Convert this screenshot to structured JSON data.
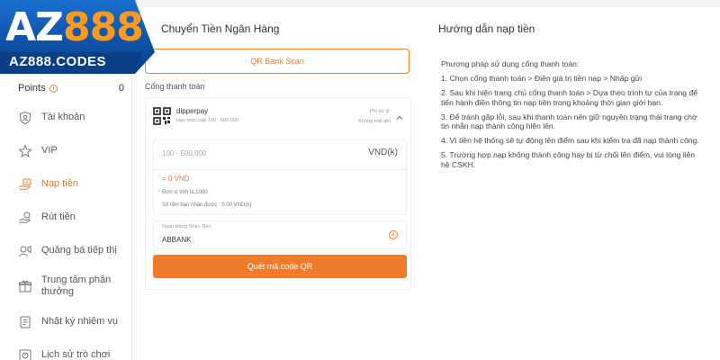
{
  "logo": {
    "brand_a": "AZ",
    "brand_n": "888",
    "url": "AZ888.CODES"
  },
  "sidebar": {
    "points_label": "Points",
    "points_value": "0",
    "items": [
      {
        "label": "Tài khoản",
        "icon": "user-shield-icon"
      },
      {
        "label": "VIP",
        "icon": "vip-star-icon"
      },
      {
        "label": "Nạp tiền",
        "icon": "deposit-hand-icon",
        "active": true
      },
      {
        "label": "Rút tiền",
        "icon": "withdraw-hand-icon"
      },
      {
        "label": "Quảng bá tiếp thị",
        "icon": "promotion-icon"
      },
      {
        "label": "Trung tâm phần thưởng",
        "icon": "gift-icon"
      },
      {
        "label": "Nhật ký nhiệm vụ",
        "icon": "task-log-icon"
      },
      {
        "label": "Lịch sử trò chơi",
        "icon": "history-icon"
      }
    ]
  },
  "main": {
    "title_left": "Chuyển Tiền Ngân Hàng",
    "title_right": "Hướng dẫn nạp tiền",
    "qr_tab": "QR Bank Scan",
    "gate_label": "Cổng thanh toán",
    "gate": {
      "name": "dipperpay",
      "limit": "Hạn mức nạp 100 - 500,000",
      "fee_line1": "Phí xử lý:",
      "fee_line2": "Không mất phí"
    },
    "amount": {
      "placeholder": "100 - 500,000",
      "unit": "VND(k)",
      "equals": "= 0 VND",
      "unit_note": "Đơn vị tính là 1000",
      "receive_note": "Số tiền bạn nhận được : 0.00 VND(k)"
    },
    "bank": {
      "label": "Ngân Hàng Nhận Tiền",
      "value": "ABBANK"
    },
    "scan_button": "Quét mã code QR",
    "guide": [
      "Phương pháp sử dụng cổng thanh toán:",
      "1. Chọn cổng thanh toán > Điền giá trị tiền nạp > Nhấp gửi",
      "2. Sau khi hiện trang chủ cổng thanh toán > Dựa theo trình tự của trang để tiến hành điền thông tin nạp tiền trong khoảng thời gian giới hạn.",
      "3. Để tránh gặp lỗi, sau khi thanh toán nên giữ nguyên trạng thái trang chờ tin nhắn nạp thành công hiện lên.",
      "4. Vì tiền hệ thống sẽ tự động lên điểm sau khi kiểm tra đã nạp thành công.",
      "5. Trường hợp nạp không thành công hay bị từ chối lên điểm, vui lòng liên hệ CSKH."
    ]
  },
  "colors": {
    "accent": "#f07b2b",
    "logo_bg": "#0a4ea6"
  }
}
